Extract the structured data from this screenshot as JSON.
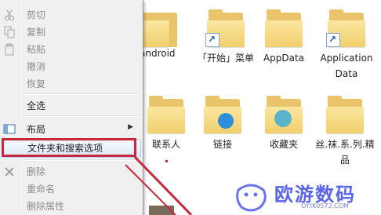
{
  "menu": {
    "items": [
      {
        "label": "剪切",
        "icon": "scissors-icon",
        "disabled": true
      },
      {
        "label": "复制",
        "icon": "copy-icon",
        "disabled": true
      },
      {
        "label": "粘贴",
        "icon": "paste-icon",
        "disabled": true
      },
      {
        "label": "撤消",
        "icon": "",
        "disabled": true
      },
      {
        "label": "恢复",
        "icon": "",
        "disabled": true
      },
      {
        "label": "全选",
        "icon": "",
        "disabled": false
      },
      {
        "label": "布局",
        "icon": "layout-icon",
        "disabled": false,
        "submenu": true
      },
      {
        "label": "文件夹和搜索选项",
        "icon": "",
        "disabled": false,
        "highlight": true
      },
      {
        "label": "删除",
        "icon": "delete-icon",
        "disabled": true
      },
      {
        "label": "重命名",
        "icon": "",
        "disabled": true
      },
      {
        "label": "删除属性",
        "icon": "",
        "disabled": true
      }
    ],
    "submenu_arrow": "▶"
  },
  "files": {
    "row1": [
      {
        "label": "android",
        "shortcut": false
      },
      {
        "label": "「开始」菜单",
        "shortcut": true
      },
      {
        "label": "AppData",
        "shortcut": false
      },
      {
        "label": "Application Data",
        "shortcut": true
      }
    ],
    "row2": [
      {
        "label": "联系人",
        "shortcut": false
      },
      {
        "label": "链接",
        "shortcut": false
      },
      {
        "label": "收藏夹",
        "shortcut": false
      },
      {
        "label": "丝.袜.系.列.精品",
        "shortcut": false
      }
    ]
  },
  "watermark": {
    "title": "欧游数码",
    "url": "OY.IK0572.COM"
  },
  "colors": {
    "highlight_border": "#aecff7",
    "annotation_red": "#c8283c",
    "watermark_blue": "#5a66e8"
  }
}
